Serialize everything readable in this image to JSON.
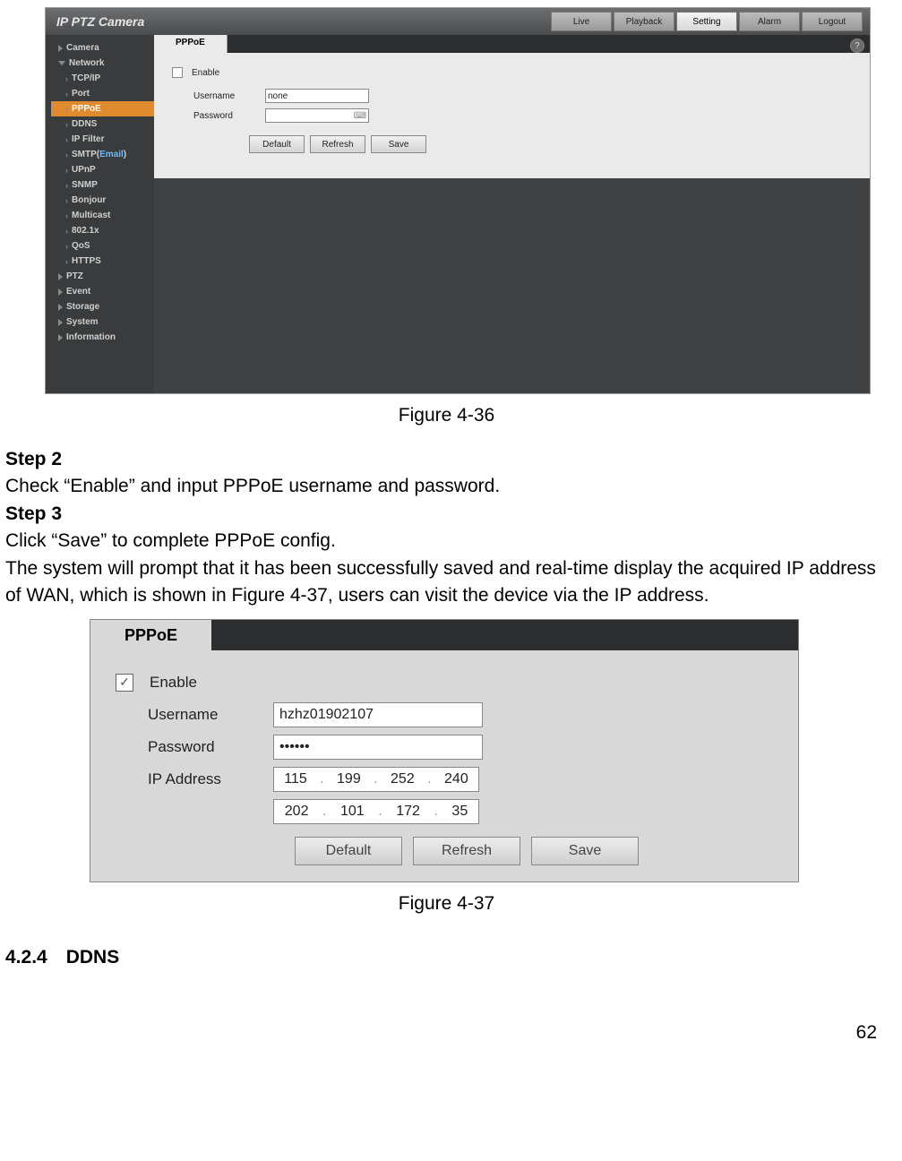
{
  "fig36": {
    "header_title": "IP PTZ Camera",
    "tabs": [
      "Live",
      "Playback",
      "Setting",
      "Alarm",
      "Logout"
    ],
    "active_tab": 2,
    "sidebar_top": [
      {
        "label": "Camera",
        "open": false
      },
      {
        "label": "Network",
        "open": true
      }
    ],
    "sidebar_sub": [
      {
        "label": "TCP/IP"
      },
      {
        "label": "Port"
      },
      {
        "label": "PPPoE",
        "active": true
      },
      {
        "label": "DDNS"
      },
      {
        "label": "IP Filter"
      },
      {
        "label": "SMTP(Email)",
        "email": true
      },
      {
        "label": "UPnP"
      },
      {
        "label": "SNMP"
      },
      {
        "label": "Bonjour"
      },
      {
        "label": "Multicast"
      },
      {
        "label": "802.1x"
      },
      {
        "label": "QoS"
      },
      {
        "label": "HTTPS"
      }
    ],
    "sidebar_bottom": [
      {
        "label": "PTZ"
      },
      {
        "label": "Event"
      },
      {
        "label": "Storage"
      },
      {
        "label": "System"
      },
      {
        "label": "Information"
      }
    ],
    "panel": {
      "tab_label": "PPPoE",
      "enable_label": "Enable",
      "username_label": "Username",
      "username_value": "none",
      "password_label": "Password",
      "btn_default": "Default",
      "btn_refresh": "Refresh",
      "btn_save": "Save"
    }
  },
  "caption36": "Figure 4-36",
  "body": {
    "step2_h": "Step 2",
    "step2_t": "Check “Enable” and input PPPoE username and password.",
    "step3_h": "Step 3",
    "step3_t": "Click “Save” to complete PPPoE config.",
    "para": "The system will prompt that it has been successfully saved and real-time display the acquired IP address of WAN, which is shown in Figure 4-37, users can visit the device via the IP address."
  },
  "fig37": {
    "tab_label": "PPPoE",
    "enable_label": "Enable",
    "username_label": "Username",
    "username_value": "hzhz01902107",
    "password_label": "Password",
    "password_mask": "••••••",
    "ip_label": "IP Address",
    "ip1": [
      "115",
      "199",
      "252",
      "240"
    ],
    "ip2": [
      "202",
      "101",
      "172",
      "35"
    ],
    "btn_default": "Default",
    "btn_refresh": "Refresh",
    "btn_save": "Save"
  },
  "caption37": "Figure 4-37",
  "section": "4.2.4 DDNS",
  "page_number": "62"
}
